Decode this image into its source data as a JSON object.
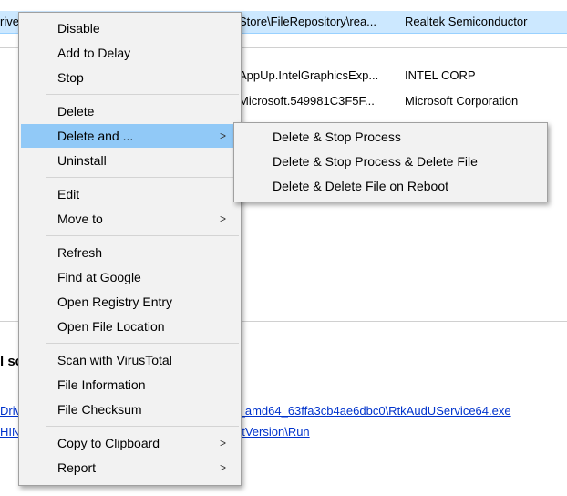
{
  "table": {
    "rows": [
      {
        "col1": "rive",
        "col2": "Store\\FileRepository\\rea...",
        "col3": "Realtek Semiconductor"
      },
      {
        "col2": "AppUp.IntelGraphicsExp...",
        "col3": "INTEL CORP"
      },
      {
        "col2": "Microsoft.549981C3F5F...",
        "col3": "Microsoft Corporation"
      }
    ]
  },
  "details": {
    "title": "l sc",
    "link1_prefix": "Driv",
    "link1_suffix": "f_amd64_63ffa3cb4ae6dbc0\\RtkAudUService64.exe",
    "link2_prefix": "HIN",
    "link2_suffix": "ntVersion\\Run"
  },
  "context_menu": {
    "items": [
      {
        "label": "Disable"
      },
      {
        "label": "Add to Delay"
      },
      {
        "label": "Stop"
      },
      {
        "label": "Delete"
      },
      {
        "label": "Delete and ...",
        "submenu": true
      },
      {
        "label": "Uninstall"
      },
      {
        "label": "Edit"
      },
      {
        "label": "Move to",
        "submenu": true
      },
      {
        "label": "Refresh"
      },
      {
        "label": "Find at Google"
      },
      {
        "label": "Open Registry Entry"
      },
      {
        "label": "Open File Location"
      },
      {
        "label": "Scan with VirusTotal"
      },
      {
        "label": "File Information"
      },
      {
        "label": "File Checksum"
      },
      {
        "label": "Copy to Clipboard",
        "submenu": true
      },
      {
        "label": "Report",
        "submenu": true
      }
    ],
    "arrow_glyph": ">"
  },
  "submenu": {
    "items": [
      {
        "label": "Delete & Stop Process"
      },
      {
        "label": "Delete & Stop Process & Delete File"
      },
      {
        "label": "Delete & Delete File on Reboot"
      }
    ]
  },
  "colors": {
    "selected_row": "#cce8ff",
    "menu_highlight": "#91c9f7",
    "link": "#0033cc"
  }
}
